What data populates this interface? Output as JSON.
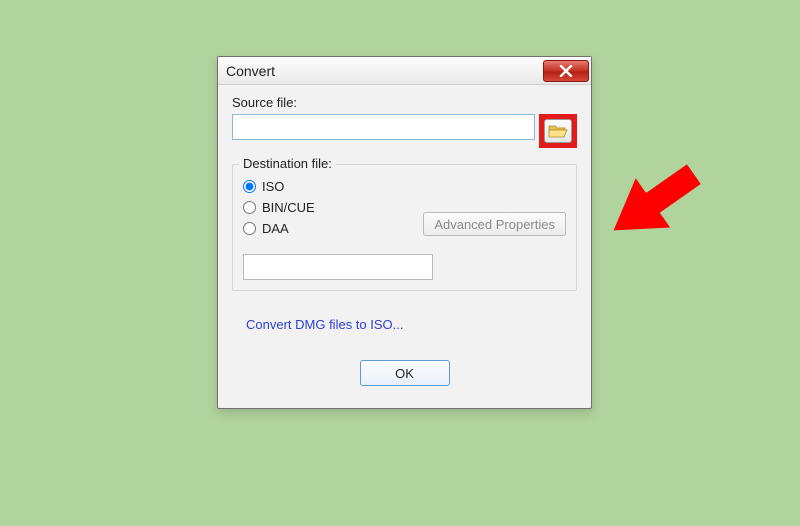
{
  "window": {
    "title": "Convert"
  },
  "source": {
    "label": "Source file:",
    "value": ""
  },
  "destination": {
    "label": "Destination file:",
    "value": ""
  },
  "radios": {
    "iso": "ISO",
    "bincue": "BIN/CUE",
    "daa": "DAA",
    "selected": "iso"
  },
  "buttons": {
    "advanced": "Advanced Properties",
    "ok": "OK"
  },
  "link": {
    "dmg": "Convert DMG files to ISO..."
  }
}
